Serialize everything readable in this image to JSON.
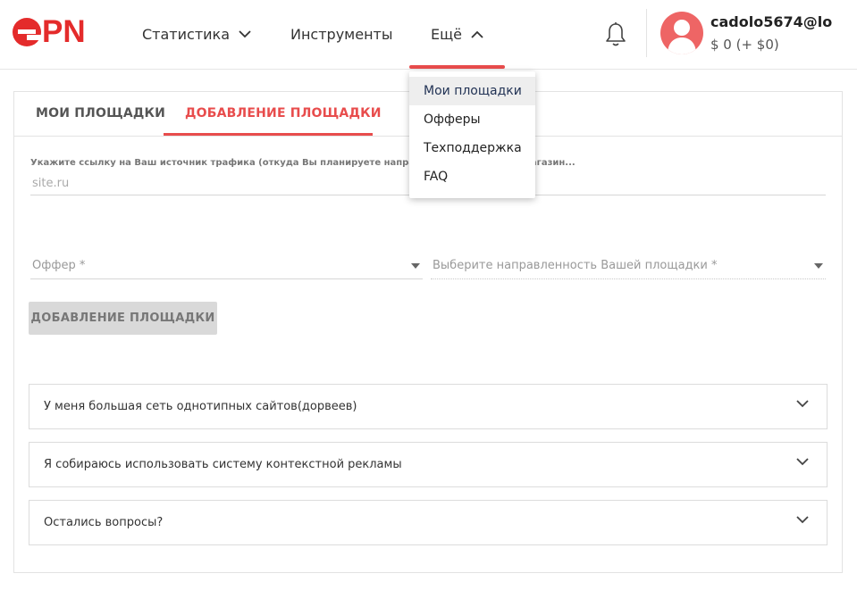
{
  "header": {
    "logo_text": "PN",
    "nav": {
      "statistics": "Статистика",
      "tools": "Инструменты",
      "more": "Ещё"
    },
    "user": {
      "email": "cadolo5674@lo",
      "balance": "$ 0 (+ $0)"
    }
  },
  "dropdown": {
    "items": [
      {
        "label": "Мои площадки",
        "active": true
      },
      {
        "label": "Офферы"
      },
      {
        "label": "Техподдержка"
      },
      {
        "label": "FAQ"
      }
    ]
  },
  "tabs": {
    "my_sites": "МОИ ПЛОЩАДКИ",
    "add_site": "ДОБАВЛЕНИЕ ПЛОЩАДКИ"
  },
  "form": {
    "hint": "Укажите ссылку на Ваш источник трафика (откуда Вы планируете направлять по... интернет-магазин...",
    "site_placeholder": "site.ru",
    "offer_placeholder": "Оффер *",
    "direction_placeholder": "Выберите направленность Вашей площадки *",
    "submit_label": "ДОБАВЛЕНИЕ ПЛОЩАДКИ"
  },
  "accordion": {
    "items": [
      {
        "label": "У меня большая сеть однотипных сайтов(дорвеев)"
      },
      {
        "label": "Я собираюсь использовать систему контекстной рекламы"
      },
      {
        "label": "Остались вопросы?"
      }
    ]
  },
  "colors": {
    "brand": "#e42b2b",
    "accent": "#e84c4c",
    "avatar": "#ee6565"
  }
}
